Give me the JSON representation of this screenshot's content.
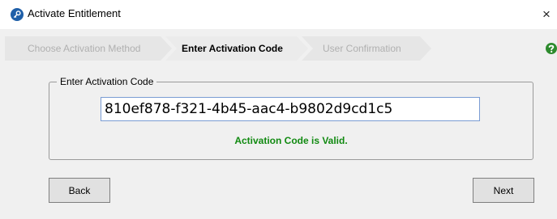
{
  "window": {
    "title": "Activate Entitlement",
    "close_label": "×",
    "icon": "key-icon"
  },
  "wizard": {
    "steps": [
      {
        "label": "Choose Activation Method",
        "state": "done"
      },
      {
        "label": "Enter Activation Code",
        "state": "active"
      },
      {
        "label": "User Confirmation",
        "state": "pending"
      }
    ],
    "help_icon": "help-icon"
  },
  "activation": {
    "group_label": "Enter Activation Code",
    "code_value": "810ef878-f321-4b45-aac4-b9802d9cd1c5",
    "status": "Activation Code is Valid."
  },
  "buttons": {
    "back_label": "Back",
    "next_label": "Next"
  },
  "colors": {
    "status_green": "#118a11",
    "help_green": "#2e8b2e",
    "icon_blue": "#1f5fa8",
    "step_bg": "#e6e6e6"
  }
}
